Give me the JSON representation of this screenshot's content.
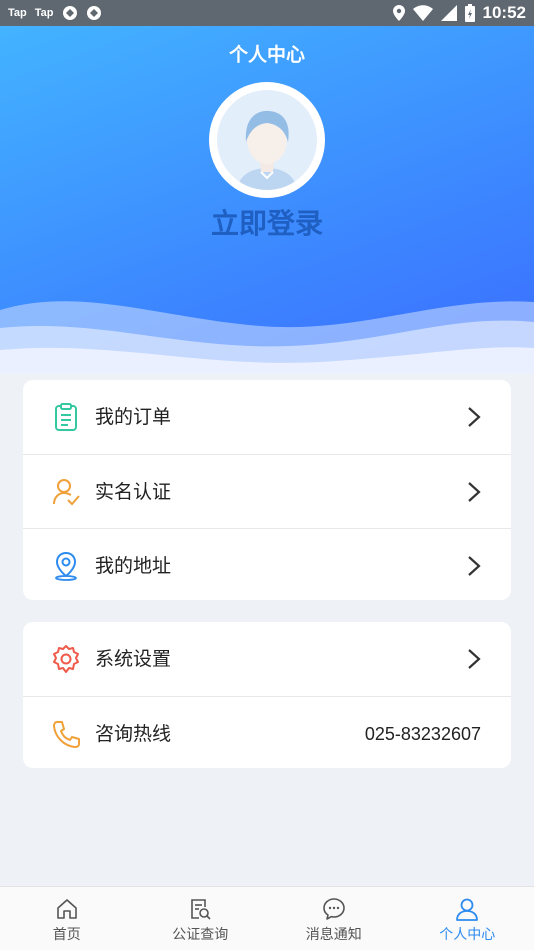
{
  "status_bar": {
    "app1": "Tap",
    "app2": "Tap",
    "time": "10:52"
  },
  "header": {
    "title": "个人中心",
    "login_label": "立即登录"
  },
  "menu_group_1": [
    {
      "label": "我的订单",
      "icon": "clipboard-icon",
      "color": "#34c8a0"
    },
    {
      "label": "实名认证",
      "icon": "user-check-icon",
      "color": "#f0a13a"
    },
    {
      "label": "我的地址",
      "icon": "location-pin-icon",
      "color": "#2e8bf0"
    }
  ],
  "menu_group_2": [
    {
      "label": "系统设置",
      "icon": "gear-icon",
      "color": "#f05a4a"
    },
    {
      "label": "咨询热线",
      "icon": "phone-icon",
      "color": "#f0a13a",
      "value": "025-83232607"
    }
  ],
  "tabs": [
    {
      "label": "首页",
      "icon": "home-icon"
    },
    {
      "label": "公证查询",
      "icon": "document-search-icon"
    },
    {
      "label": "消息通知",
      "icon": "chat-bubble-icon"
    },
    {
      "label": "个人中心",
      "icon": "person-icon",
      "active": true
    }
  ],
  "colors": {
    "header_gradient_start": "#43b3ff",
    "header_gradient_end": "#3a6cff",
    "active_tab": "#2e8bf0",
    "login_text": "#1f5fc2"
  }
}
